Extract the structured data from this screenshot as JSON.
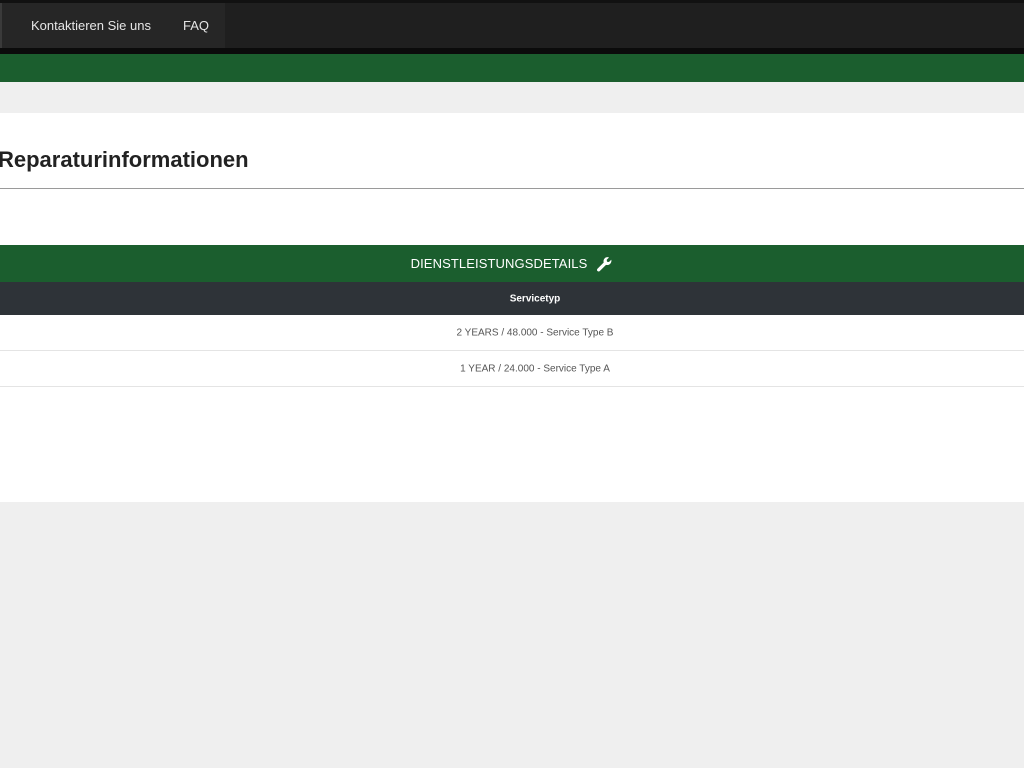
{
  "nav": {
    "items": [
      {
        "label": "Kontaktieren Sie uns"
      },
      {
        "label": "FAQ"
      }
    ]
  },
  "page": {
    "title": "Reparaturinformationen"
  },
  "service_table": {
    "heading": "DIENSTLEISTUNGSDETAILS",
    "heading_icon": "wrench-icon",
    "columns": [
      "Servicetyp"
    ],
    "rows": [
      {
        "service_type": "2 YEARS / 48.000 - Service Type B"
      },
      {
        "service_type": "1 YEAR / 24.000 - Service Type A"
      }
    ]
  },
  "colors": {
    "nav_bg": "#1f1f1f",
    "brand_green": "#1b5e2e",
    "table_header_dark": "#2e3338",
    "page_bg": "#efefef"
  }
}
